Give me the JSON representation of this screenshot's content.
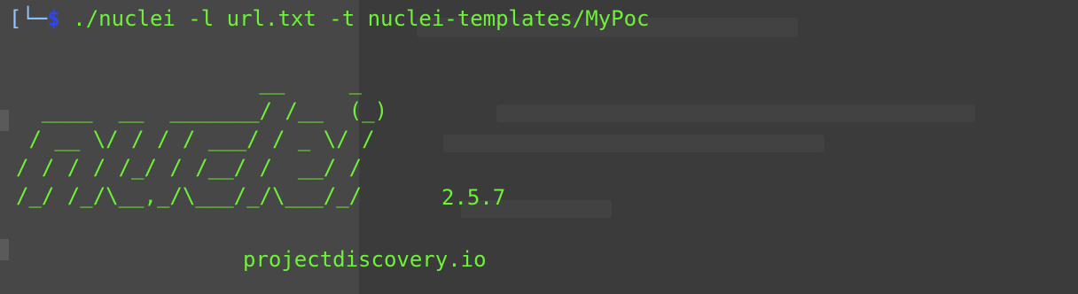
{
  "terminal": {
    "prompt_tree": "[└─",
    "prompt_symbol": "$",
    "command": " ./nuclei -l url.txt -t nuclei-templates/MyPoc"
  },
  "banner": {
    "ascii_lines": [
      "                   __     _",
      "  ____  __  _______/ /__  (_)",
      " / __ \\/ / / / ___/ / _ \\/ /",
      "/ / / / /_/ / /__/ /  __/ /",
      "/_/ /_/\\__,_/\\___/_/\\___/_/"
    ],
    "version": "2.5.7",
    "site": "projectdiscovery.io"
  }
}
